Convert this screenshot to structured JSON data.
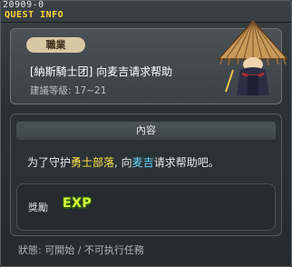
{
  "quest_id": "20909-0",
  "window_title": "QUEST INFO",
  "job_badge": "職業",
  "quest_name": "[納斯騎士团] 向麦吉请求帮助",
  "recommended_level": "建議等級: 17~21",
  "content_header": "內容",
  "description": {
    "prefix": "为了守护",
    "highlight1": "勇士部落",
    "middle": ", 向",
    "highlight2": "麦吉",
    "suffix": "请求帮助吧。"
  },
  "reward": {
    "label": "獎勵",
    "item": "EXP"
  },
  "status_text": "狀態: 可開始 / 不可执行任務",
  "colors": {
    "title": "#ffd43a",
    "highlight1": "#ffe24a",
    "highlight2": "#66d8ff",
    "exp": "#d7ff3a"
  },
  "icons": {
    "npc": "npc-portrait-straw-hat",
    "exp": "exp-icon"
  }
}
